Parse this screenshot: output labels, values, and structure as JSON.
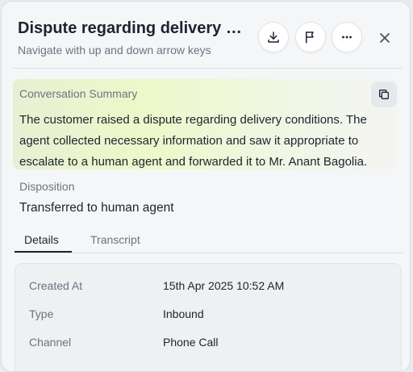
{
  "header": {
    "title": "Dispute regarding delivery conditions",
    "subtitle": "Navigate with up and down arrow keys",
    "icons": [
      "download-icon",
      "flag-icon",
      "more-horizontal-icon",
      "close-icon"
    ]
  },
  "summary": {
    "label": "Conversation Summary",
    "text": "The customer raised a dispute regarding delivery conditions. The agent collected necessary information and saw it appropriate to escalate to a human agent and forwarded it to Mr. Anant Bagolia.",
    "copy_icon": "copy-icon"
  },
  "disposition": {
    "label": "Disposition",
    "value": "Transferred to human agent"
  },
  "tabs": [
    {
      "label": "Details",
      "active": true
    },
    {
      "label": "Transcript",
      "active": false
    }
  ],
  "details": {
    "rows": [
      {
        "label": "Created At",
        "value": "15th Apr 2025 10:52 AM"
      },
      {
        "label": "Type",
        "value": "Inbound"
      },
      {
        "label": "Channel",
        "value": "Phone Call"
      }
    ]
  },
  "colors": {
    "text_primary": "#1c2430",
    "text_muted": "#6b7480",
    "summary_highlight": "#eef8c9"
  }
}
